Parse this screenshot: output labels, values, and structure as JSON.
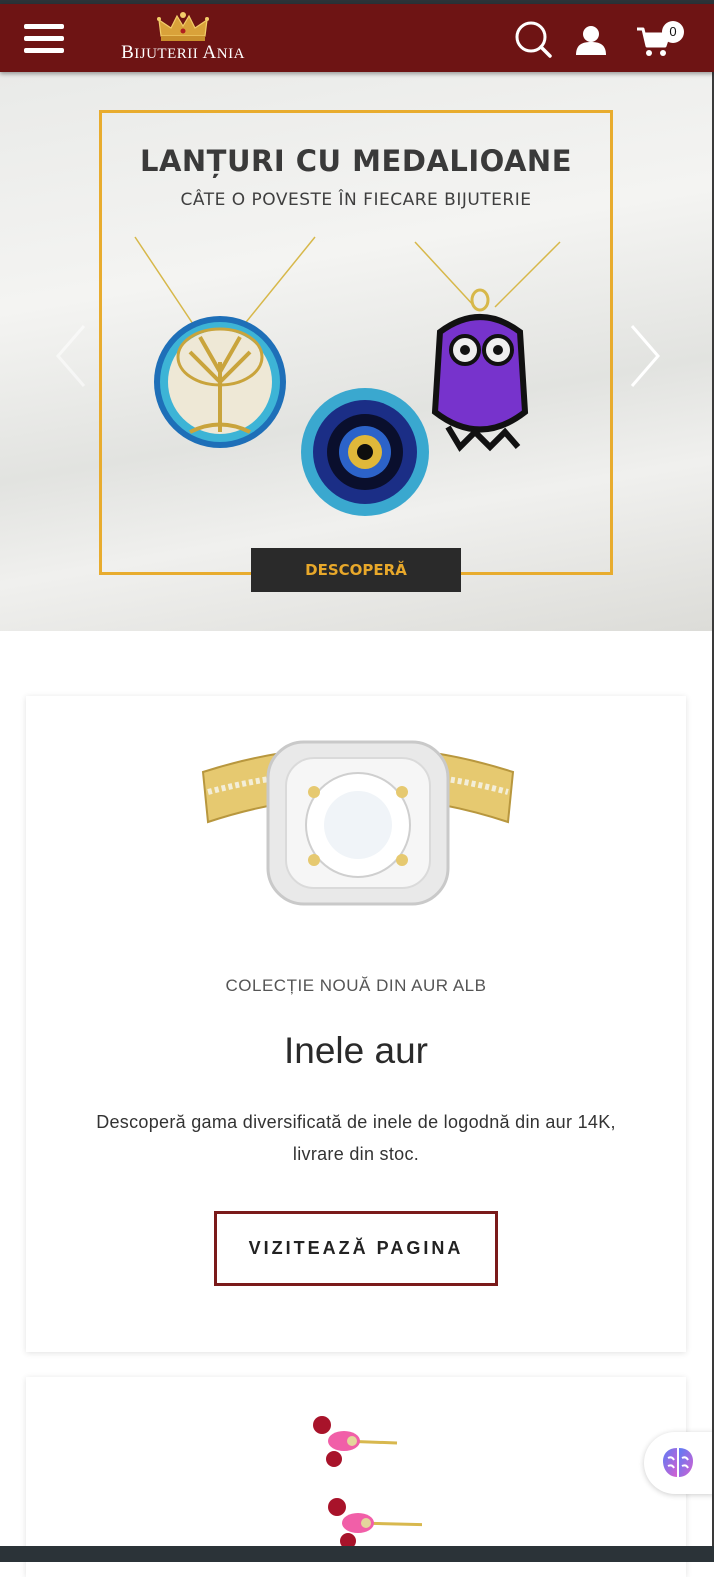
{
  "header": {
    "brand_first": "B",
    "brand_rest1": "IJUTERII ",
    "brand_first2": "A",
    "brand_rest2": "NIA",
    "cart_count": "0",
    "bg_color": "#6e1414"
  },
  "hero": {
    "title": "LANȚURI CU MEDALIOANE",
    "subtitle": "CÂTE O POVESTE ÎN FIECARE BIJUTERIE",
    "cta": "DESCOPERĂ",
    "accent": "#e8ac2e"
  },
  "cards": [
    {
      "kicker": "COLECȚIE NOUĂ DIN AUR ALB",
      "title": "Inele aur",
      "description": "Descoperă gama diversificată de inele de logodnă din aur 14K, livrare din stoc.",
      "button": "VIZITEAZĂ PAGINA"
    }
  ],
  "icons": [
    "menu-icon",
    "crown-logo-icon",
    "search-icon",
    "user-icon",
    "cart-icon",
    "chevron-left-icon",
    "chevron-right-icon",
    "brain-widget-icon"
  ]
}
